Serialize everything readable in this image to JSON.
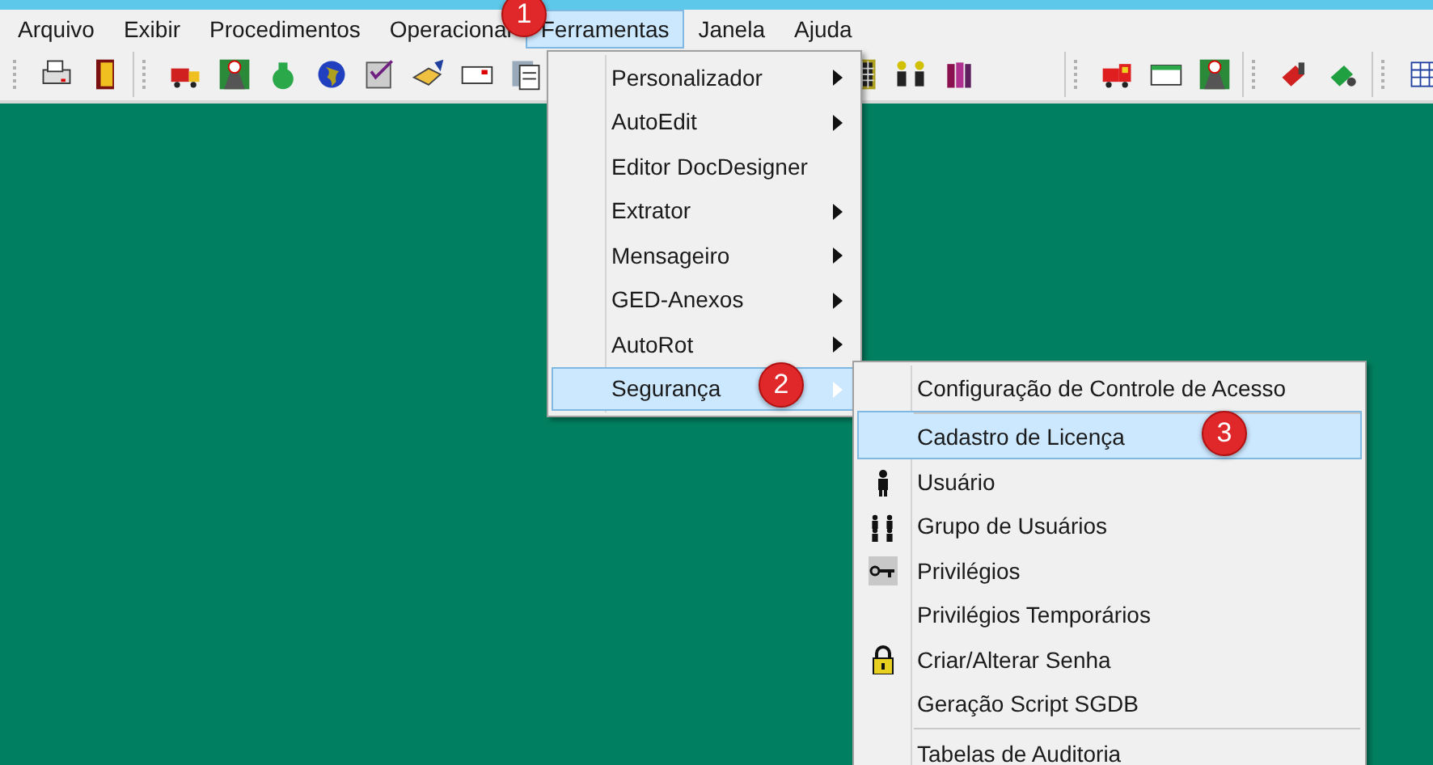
{
  "menubar": [
    {
      "label": "Arquivo",
      "selected": false
    },
    {
      "label": "Exibir",
      "selected": false
    },
    {
      "label": "Procedimentos",
      "selected": false
    },
    {
      "label": "Operacional",
      "selected": false
    },
    {
      "label": "Ferramentas",
      "selected": true
    },
    {
      "label": "Janela",
      "selected": false
    },
    {
      "label": "Ajuda",
      "selected": false
    }
  ],
  "menu": [
    {
      "label": "Personalizador",
      "submenu": true,
      "selected": false
    },
    {
      "label": "AutoEdit",
      "submenu": true,
      "selected": false
    },
    {
      "label": "Editor DocDesigner",
      "submenu": false,
      "selected": false
    },
    {
      "label": "Extrator",
      "submenu": true,
      "selected": false
    },
    {
      "label": "Mensageiro",
      "submenu": true,
      "selected": false
    },
    {
      "label": "GED-Anexos",
      "submenu": true,
      "selected": false
    },
    {
      "label": "AutoRot",
      "submenu": true,
      "selected": false
    },
    {
      "label": "Segurança",
      "submenu": true,
      "selected": true
    }
  ],
  "submenu": [
    {
      "label": "Configuração de Controle de Acesso",
      "selected": false,
      "separator_before": false
    },
    {
      "label": "Cadastro de Licença",
      "selected": true,
      "separator_before": true
    },
    {
      "label": "Usuário",
      "selected": false,
      "separator_before": false
    },
    {
      "label": "Grupo de Usuários",
      "selected": false,
      "separator_before": false
    },
    {
      "label": "Privilégios",
      "selected": false,
      "separator_before": false
    },
    {
      "label": "Privilégios Temporários",
      "selected": false,
      "separator_before": false
    },
    {
      "label": "Criar/Alterar Senha",
      "selected": false,
      "separator_before": false
    },
    {
      "label": "Geração Script SGDB",
      "selected": false,
      "separator_before": false
    },
    {
      "label": "Tabelas de Auditoria",
      "selected": false,
      "separator_before": true
    }
  ],
  "callouts": [
    "1",
    "2",
    "3"
  ]
}
